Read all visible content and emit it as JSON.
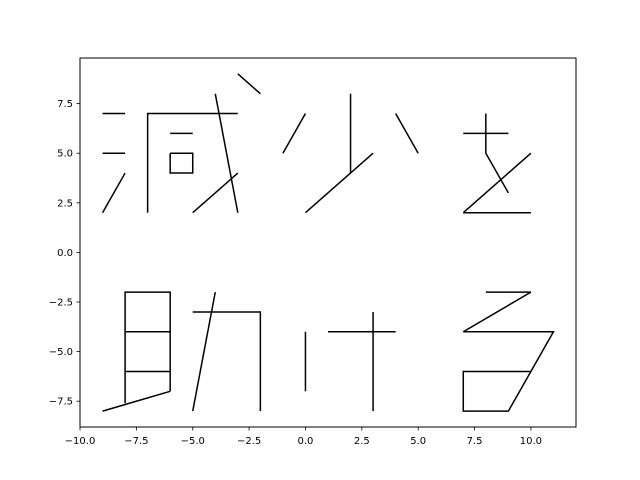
{
  "chart_data": {
    "type": "line",
    "title": "",
    "xlabel": "",
    "ylabel": "",
    "xlim": [
      -10,
      12
    ],
    "ylim": [
      -8.8,
      9.8
    ],
    "xticks": [
      -10,
      -7.5,
      -5,
      -2.5,
      0,
      2.5,
      5,
      7.5,
      10
    ],
    "xtick_labels": [
      "−10.0",
      "−7.5",
      "−5.0",
      "−2.5",
      "0.0",
      "2.5",
      "5.0",
      "7.5",
      "10.0"
    ],
    "yticks": [
      -7.5,
      -5,
      -2.5,
      0,
      2.5,
      5,
      7.5
    ],
    "ytick_labels": [
      "−7.5",
      "−5.0",
      "−2.5",
      "0.0",
      "2.5",
      "5.0",
      "7.5"
    ],
    "grid": false,
    "line_color": "#000000",
    "segments": [
      [
        [
          -9,
          7
        ],
        [
          -8,
          7
        ]
      ],
      [
        [
          -9,
          5
        ],
        [
          -8,
          5
        ]
      ],
      [
        [
          -9,
          2
        ],
        [
          -8,
          4
        ]
      ],
      [
        [
          -7,
          2
        ],
        [
          -7,
          7
        ],
        [
          -3,
          7
        ]
      ],
      [
        [
          -6,
          6
        ],
        [
          -5,
          6
        ]
      ],
      [
        [
          -6,
          5
        ],
        [
          -5,
          5
        ],
        [
          -5,
          4
        ],
        [
          -6,
          4
        ],
        [
          -6,
          5
        ]
      ],
      [
        [
          -5,
          2
        ],
        [
          -3,
          4
        ]
      ],
      [
        [
          -4,
          8
        ],
        [
          -3,
          2
        ]
      ],
      [
        [
          -3,
          9
        ],
        [
          -2,
          8
        ]
      ],
      [
        [
          -1,
          5
        ],
        [
          0,
          7
        ]
      ],
      [
        [
          2,
          8
        ],
        [
          2,
          4
        ]
      ],
      [
        [
          0,
          2
        ],
        [
          3,
          5
        ]
      ],
      [
        [
          4,
          7
        ],
        [
          5,
          5
        ]
      ],
      [
        [
          7,
          6
        ],
        [
          9,
          6
        ]
      ],
      [
        [
          8,
          7
        ],
        [
          8,
          5
        ],
        [
          9,
          3
        ]
      ],
      [
        [
          7,
          2
        ],
        [
          10,
          5
        ]
      ],
      [
        [
          7,
          2
        ],
        [
          10,
          2
        ]
      ],
      [
        [
          -8,
          -7.6
        ],
        [
          -8,
          -2
        ],
        [
          -6,
          -2
        ],
        [
          -6,
          -7
        ]
      ],
      [
        [
          -8,
          -4
        ],
        [
          -6,
          -4
        ]
      ],
      [
        [
          -8,
          -6
        ],
        [
          -6,
          -6
        ]
      ],
      [
        [
          -9,
          -8
        ],
        [
          -6,
          -7
        ]
      ],
      [
        [
          -5,
          -3
        ],
        [
          -2,
          -3
        ],
        [
          -2,
          -8
        ]
      ],
      [
        [
          -4,
          -2
        ],
        [
          -5,
          -8
        ]
      ],
      [
        [
          0,
          -4
        ],
        [
          0,
          -7
        ]
      ],
      [
        [
          1,
          -4
        ],
        [
          4,
          -4
        ]
      ],
      [
        [
          3,
          -3
        ],
        [
          3,
          -8
        ]
      ],
      [
        [
          8,
          -2
        ],
        [
          10,
          -2
        ]
      ],
      [
        [
          10,
          -2
        ],
        [
          7,
          -4
        ]
      ],
      [
        [
          7,
          -4
        ],
        [
          11,
          -4
        ],
        [
          9,
          -8
        ],
        [
          7,
          -8
        ],
        [
          7,
          -6
        ],
        [
          10,
          -6
        ]
      ]
    ]
  }
}
